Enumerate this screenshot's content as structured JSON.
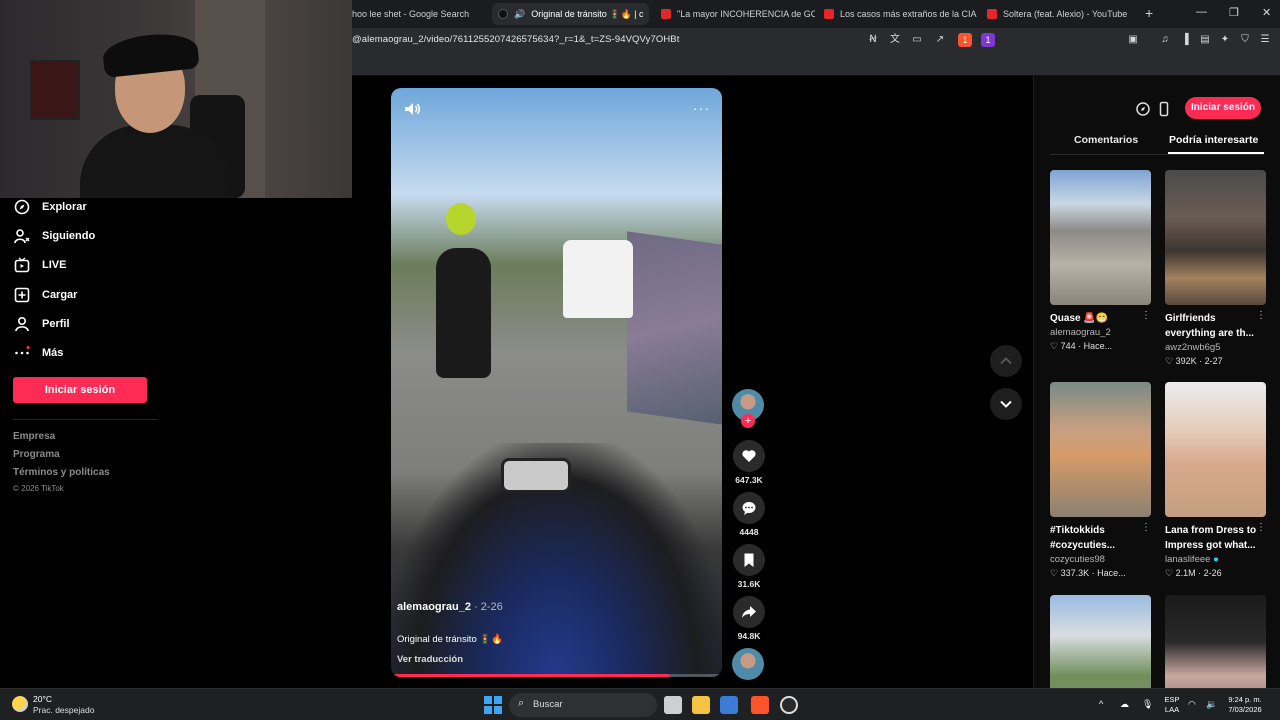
{
  "browser": {
    "tabs": [
      {
        "label": "hoo lee shet - Google Search",
        "type": "google"
      },
      {
        "label": "Original de tránsito 🚦🔥 | c",
        "type": "tiktok",
        "active": true
      },
      {
        "label": "\"La mayor INCOHERENCIA de GOD",
        "type": "youtube"
      },
      {
        "label": "Los casos más extraños de la CIA - Y",
        "type": "youtube"
      },
      {
        "label": "Soltera (feat. Alexio) - YouTube",
        "type": "youtube"
      }
    ],
    "new_tab": "+",
    "url": "@alemaograu_2/video/7611255207426575634?_r=1&_t=ZS-94VQVy7OHBt",
    "brave_badge": "1",
    "alert_badge": "1"
  },
  "sidebar": {
    "items": [
      {
        "label": "Explorar",
        "icon": "compass-icon"
      },
      {
        "label": "Siguiendo",
        "icon": "user-follow-icon"
      },
      {
        "label": "LIVE",
        "icon": "live-tv-icon"
      },
      {
        "label": "Cargar",
        "icon": "upload-plus-icon"
      },
      {
        "label": "Perfil",
        "icon": "person-icon"
      },
      {
        "label": "Más",
        "icon": "more-dots-icon"
      }
    ],
    "login": "Iniciar sesión",
    "footer_links": [
      "Empresa",
      "Programa",
      "Términos y políticas"
    ],
    "copyright": "© 2026 TikTok"
  },
  "video": {
    "username": "alemaograu_2",
    "date": "· 2-26",
    "caption": "Original de tránsito 🚦🔥",
    "translate": "Ver traducción",
    "progress_fraction": 0.84,
    "more": "···"
  },
  "actions": {
    "likes": "647.3K",
    "comments": "4448",
    "saves": "31.6K",
    "shares": "94.8K"
  },
  "right_panel": {
    "login": "Iniciar sesión",
    "tabs": [
      "Comentarios",
      "Podría interesarte"
    ],
    "active_tab": 1,
    "cards": [
      {
        "title": "Quase 🚨😁",
        "user": "alemaograu_2",
        "meta": "♡ 744 · Hace..."
      },
      {
        "title": "Girlfriends everything are th...",
        "user": "awz2nwb6g5",
        "meta": "♡ 392K · 2-27"
      },
      {
        "title": "#Tiktokkids #cozycuties...",
        "user": "cozycuties98",
        "meta": "♡ 337.3K · Hace..."
      },
      {
        "title": "Lana from Dress to Impress got what...",
        "user": "lanaslifeee",
        "meta": "♡ 2.1M · 2-26"
      },
      {
        "title": "",
        "user": "",
        "meta": ""
      },
      {
        "title": "",
        "user": "",
        "meta": ""
      }
    ]
  },
  "taskbar": {
    "temperature": "20°C",
    "weather": "Prac. despejado",
    "search": "Buscar",
    "lang_top": "ESP",
    "lang_bottom": "LAA",
    "time": "9:24 p. m.",
    "date": "7/03/2026"
  },
  "colors": {
    "accent": "#fe2c55",
    "background": "#000000",
    "panel": "#0c0c0c"
  }
}
